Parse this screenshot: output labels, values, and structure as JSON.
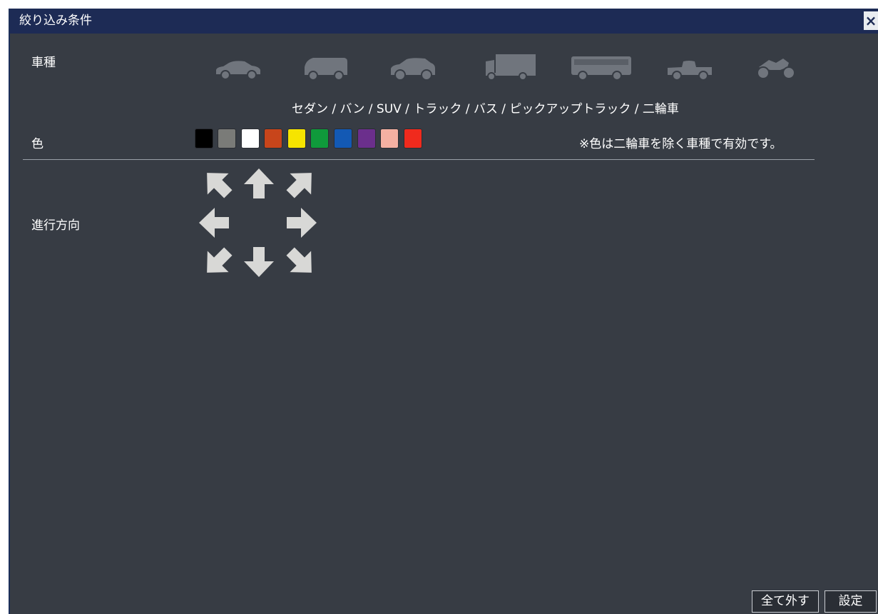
{
  "dialog": {
    "title": "絞り込み条件",
    "close_label": "×"
  },
  "vehicle_type": {
    "label": "車種",
    "icons": [
      "sedan-icon",
      "van-icon",
      "suv-icon",
      "truck-icon",
      "bus-icon",
      "pickup-truck-icon",
      "motorcycle-icon"
    ],
    "caption": "セダン / バン / SUV / トラック / バス / ピックアップトラック / 二輪車"
  },
  "color": {
    "label": "色",
    "swatches": [
      "#000000",
      "#7a7b78",
      "#ffffff",
      "#c8451b",
      "#f6e400",
      "#0f9a3b",
      "#1359b4",
      "#6b2f8c",
      "#f5b0a2",
      "#f02a1d"
    ],
    "note": "※色は二輪車を除く車種で有効です。"
  },
  "direction": {
    "label": "進行方向",
    "arrows": [
      "up-left-arrow-icon",
      "up-arrow-icon",
      "up-right-arrow-icon",
      "left-arrow-icon",
      "right-arrow-icon",
      "down-left-arrow-icon",
      "down-arrow-icon",
      "down-right-arrow-icon"
    ]
  },
  "buttons": {
    "clear_all": "全て外す",
    "apply": "設定"
  },
  "colors": {
    "titlebar": "#1d2b55",
    "panel": "#373c44",
    "icon_inactive": "#70757d",
    "arrow": "#d8d8d6"
  }
}
